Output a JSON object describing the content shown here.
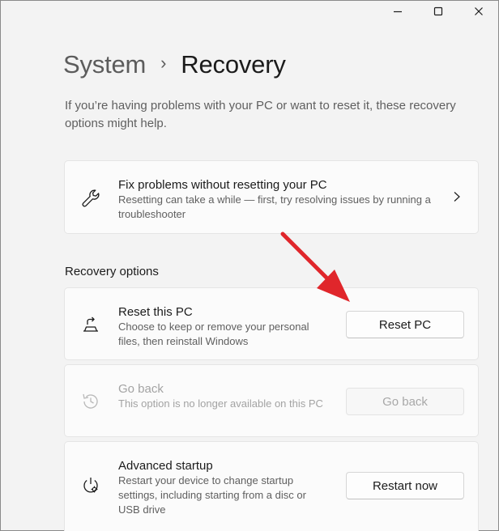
{
  "window": {
    "controls": {
      "minimize": "minimize-icon",
      "maximize": "maximize-icon",
      "close": "close-icon"
    }
  },
  "breadcrumb": {
    "parent": "System",
    "separator": "›",
    "current": "Recovery"
  },
  "intro": "If you’re having problems with your PC or want to reset it, these recovery options might help.",
  "fix_card": {
    "icon": "wrench-icon",
    "title": "Fix problems without resetting your PC",
    "description": "Resetting can take a while — first, try resolving issues by running a troubleshooter",
    "chevron": "chevron-right-icon"
  },
  "recovery_options": {
    "heading": "Recovery options",
    "items": [
      {
        "icon": "reset-pc-icon",
        "title": "Reset this PC",
        "description": "Choose to keep or remove your personal files, then reinstall Windows",
        "button": "Reset PC",
        "enabled": true
      },
      {
        "icon": "history-icon",
        "title": "Go back",
        "description": "This option is no longer available on this PC",
        "button": "Go back",
        "enabled": false
      },
      {
        "icon": "advanced-startup-icon",
        "title": "Advanced startup",
        "description": "Restart your device to change startup settings, including starting from a disc or USB drive",
        "button": "Restart now",
        "enabled": true
      }
    ]
  },
  "colors": {
    "background": "#f3f3f3",
    "card": "#fbfbfb",
    "annotation_arrow": "#e0262b"
  }
}
